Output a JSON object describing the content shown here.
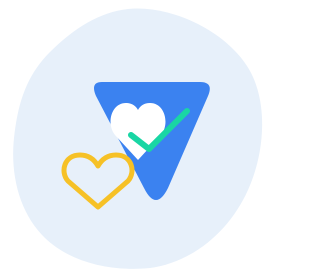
{
  "illustration": {
    "name": "health-verified",
    "icons": [
      "blob-background",
      "rounded-triangle-badge",
      "white-heart-icon",
      "check-icon",
      "outline-heart-icon"
    ],
    "colors": {
      "background_blob": "#e7f0fa",
      "badge": "#3b82f0",
      "inner_heart": "#ffffff",
      "check": "#19d6a4",
      "outline_heart": "#f6c126"
    }
  }
}
